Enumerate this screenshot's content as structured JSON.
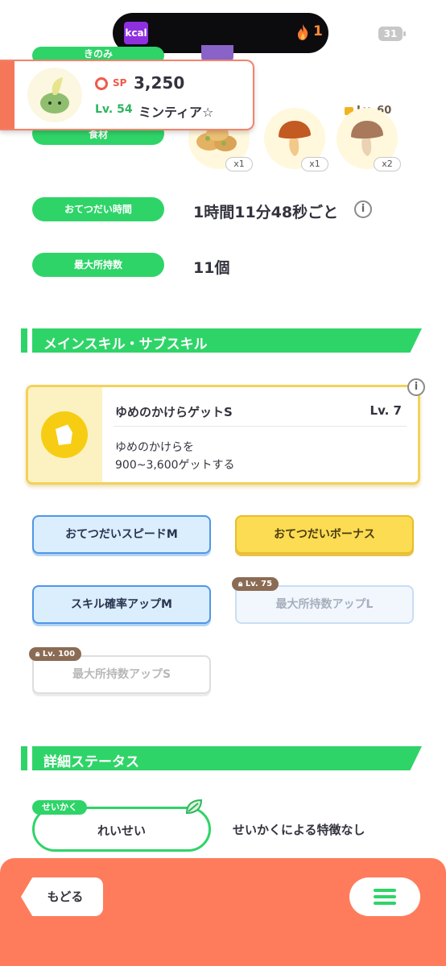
{
  "status": {
    "kcal_badge": "kcal",
    "fire_count": "1",
    "battery": "31"
  },
  "pokemon_card": {
    "sp_label": "SP",
    "sp_value": "3,250",
    "level_label": "Lv. 54",
    "name": "ミンティア☆"
  },
  "partial_labels": {
    "berry": "きのみ",
    "ingredient": "食材"
  },
  "ingredients": {
    "items": [
      {
        "count": "x1"
      },
      {
        "count": "x1"
      },
      {
        "count": "x2"
      }
    ],
    "unlock_level": "Lv. 60"
  },
  "rows": [
    {
      "label": "おてつだい時間",
      "value": "1時間11分48秒ごと"
    },
    {
      "label": "最大所持数",
      "value": "11個"
    }
  ],
  "sections": {
    "skills_title": "メインスキル・サブスキル",
    "details_title": "詳細ステータス"
  },
  "main_skill": {
    "name": "ゆめのかけらゲットS",
    "level": "Lv. 7",
    "desc_line1": "ゆめのかけらを",
    "desc_line2": "900~3,600ゲットする"
  },
  "sub_skills": [
    {
      "label": "おてつだいスピードM"
    },
    {
      "label": "おてつだいボーナス"
    },
    {
      "label": "スキル確率アップM"
    },
    {
      "label": "最大所持数アップL",
      "lock": "Lv. 75"
    },
    {
      "label": "最大所持数アップS",
      "lock": "Lv. 100"
    }
  ],
  "nature": {
    "tag": "せいかく",
    "value": "れいせい",
    "description": "せいかくによる特徴なし"
  },
  "nav": {
    "back_label": "もどる"
  },
  "colors": {
    "green": "#2fd468",
    "coral": "#fe7c5b",
    "gold": "#f6cd12",
    "blue": "#4e97e6"
  }
}
